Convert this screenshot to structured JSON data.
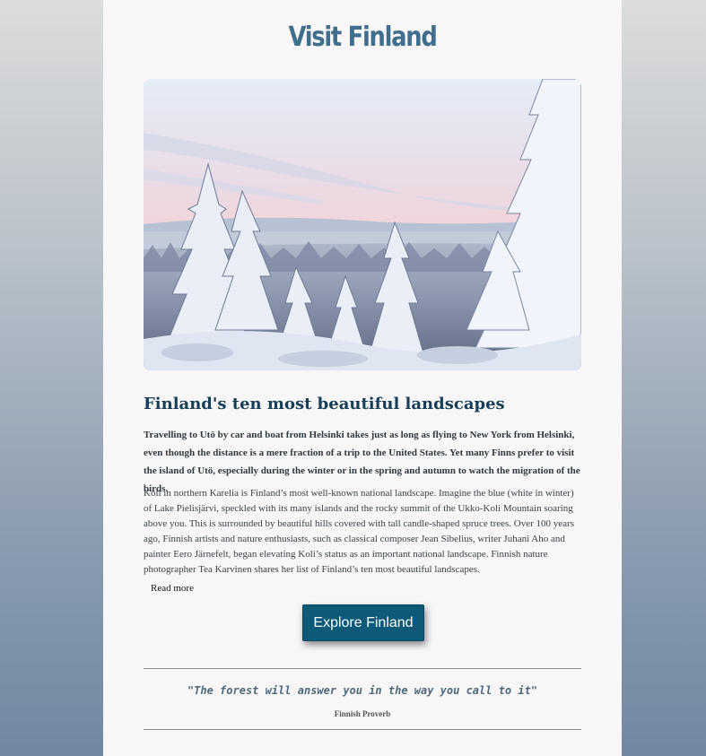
{
  "header": {
    "title": "Visit Finland"
  },
  "hero": {
    "image_subject": "snow-covered forest landscape at dusk"
  },
  "article": {
    "heading": "Finland's ten most beautiful landscapes",
    "lead": "Travelling to Utö by car and boat from Helsinki takes just as long as flying to New York from Helsinki, even though the distance is a mere fraction of a trip to the United States. Yet many Finns prefer to visit the island of Utö, especially during the winter or in the spring and autumn to watch the migration of the birds.",
    "body": "Koli in northern Karelia is Finland’s most well-known national landscape. Imagine the blue (white in winter) of Lake Pielisjärvi, speckled with its many islands and the rocky summit of the Ukko-Koli Mountain soaring above you. This is surrounded by beautiful hills covered with tall candle-shaped spruce trees. Over 100 years ago, Finnish artists and nature enthusiasts, such as classical composer Jean Sibelius, writer Juhani Aho and painter Eero Järnefelt, began elevating Koli’s status as an important national landscape. Finnish nature photographer Tea Karvinen shares her list of Finland’s ten most beautiful landscapes.",
    "read_more_label": "Read more"
  },
  "cta": {
    "label": "Explore Finland",
    "color": "#0d5a78"
  },
  "quote": {
    "text": "\"The forest will answer you in the way you call to it\"",
    "source": "Finnish Proverb"
  }
}
